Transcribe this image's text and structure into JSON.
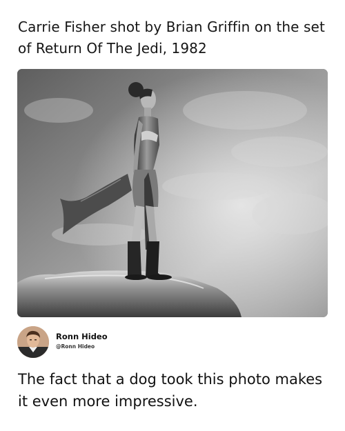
{
  "post": {
    "headline": "Carrie Fisher shot by Brian Griffin on the set of Return Of The Jedi, 1982",
    "author": {
      "name": "Ronn Hideo",
      "handle": "@Ronn Hideo"
    },
    "caption": "The fact that a dog took this photo makes it even more impressive."
  }
}
